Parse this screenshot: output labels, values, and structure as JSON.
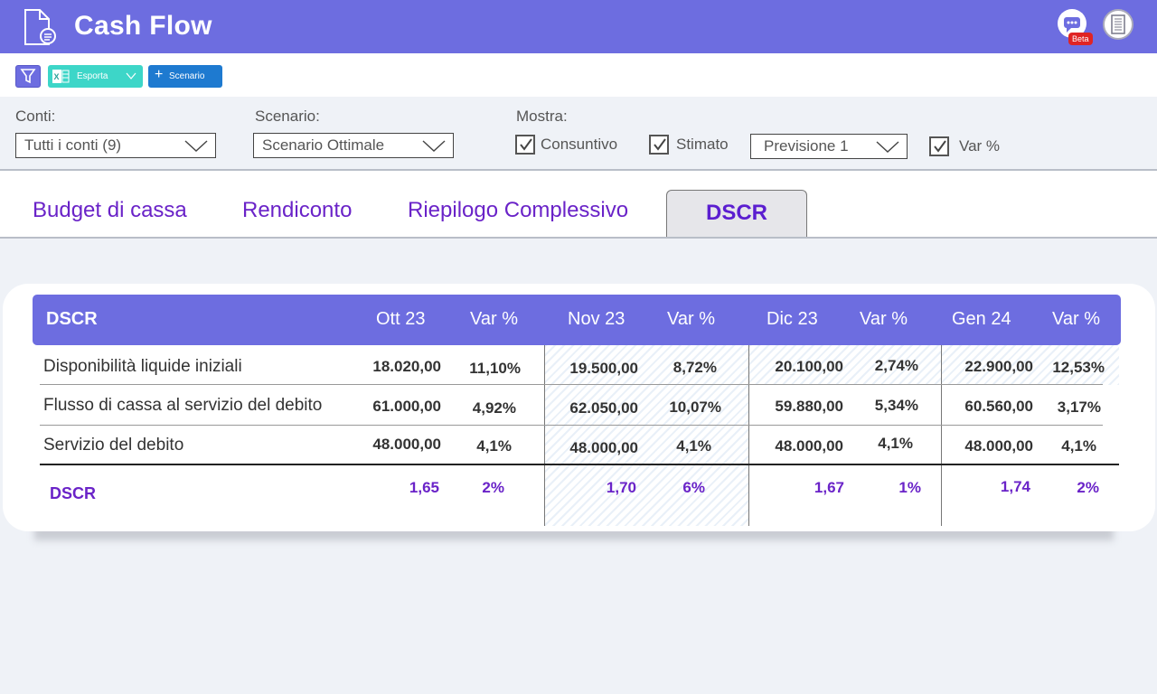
{
  "app": {
    "title": "Cash Flow",
    "beta_badge": "Beta",
    "header_color": "#6d6de0"
  },
  "toolbar": {
    "filter_icon": "filter-icon",
    "export_label": "Esporta",
    "scenario_label": "Scenario",
    "scenario_plus": "+"
  },
  "filters": {
    "conti_label": "Conti:",
    "conti_value": "Tutti i conti (9)",
    "scenario_label": "Scenario:",
    "scenario_value": "Scenario Ottimale",
    "mostra_label": "Mostra:",
    "consuntivo_label": "Consuntivo",
    "consuntivo_checked": true,
    "stimato_label": "Stimato",
    "stimato_checked": true,
    "previsione_value": "Previsione 1",
    "var_label": "Var %",
    "var_checked": true
  },
  "tabs": [
    {
      "label": "Budget di cassa",
      "active": false
    },
    {
      "label": "Rendiconto",
      "active": false
    },
    {
      "label": "Riepilogo Complessivo",
      "active": false
    },
    {
      "label": "DSCR",
      "active": true
    }
  ],
  "table": {
    "title": "DSCR",
    "columns": [
      "Ott 23",
      "Var %",
      "Nov 23",
      "Var %",
      "Dic 23",
      "Var %",
      "Gen 24",
      "Var %"
    ],
    "rows": [
      {
        "label": "Disponibilità liquide iniziali",
        "values": [
          "18.020,00",
          "11,10%",
          "19.500,00",
          "8,72%",
          "20.100,00",
          "2,74%",
          "22.900,00",
          "12,53%"
        ]
      },
      {
        "label": "Flusso di cassa al servizio del debito",
        "values": [
          "61.000,00",
          "4,92%",
          "62.050,00",
          "10,07%",
          "59.880,00",
          "5,34%",
          "60.560,00",
          "3,17%"
        ]
      },
      {
        "label": "Servizio del debito",
        "values": [
          "48.000,00",
          "4,1%",
          "48.000,00",
          "4,1%",
          "48.000,00",
          "4,1%",
          "48.000,00",
          "4,1%"
        ]
      }
    ],
    "total": {
      "label": "DSCR",
      "values": [
        "1,65",
        "2%",
        "1,70",
        "6%",
        "1,67",
        "1%",
        "1,74",
        "2%"
      ]
    }
  }
}
